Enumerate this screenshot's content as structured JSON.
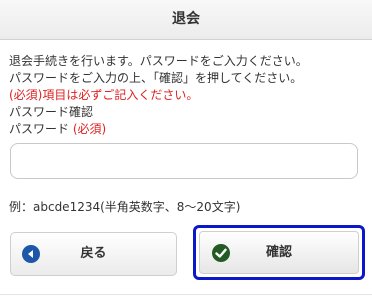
{
  "header": {
    "title": "退会"
  },
  "instructions": {
    "line1": "退会手続きを行います。パスワードをご入力ください。",
    "line2": "パスワードをご入力の上、「確認」を押してください。",
    "required_note": "(必須)項目は必ずご記入ください。"
  },
  "form": {
    "section_title": "パスワード確認",
    "password_label": "パスワード",
    "required_badge": "(必須)",
    "password_value": "",
    "password_placeholder": "",
    "example_hint": "例：abcde1234(半角英数字、8～20文字)"
  },
  "buttons": {
    "back_label": "戻る",
    "back_icon": "chevron-left-icon",
    "confirm_label": "確認",
    "confirm_icon": "check-icon"
  },
  "colors": {
    "required": "#e02020",
    "focus_border": "#0a18c9",
    "back_icon_bg": "#1f57a8",
    "check_icon_bg": "#245a24"
  }
}
